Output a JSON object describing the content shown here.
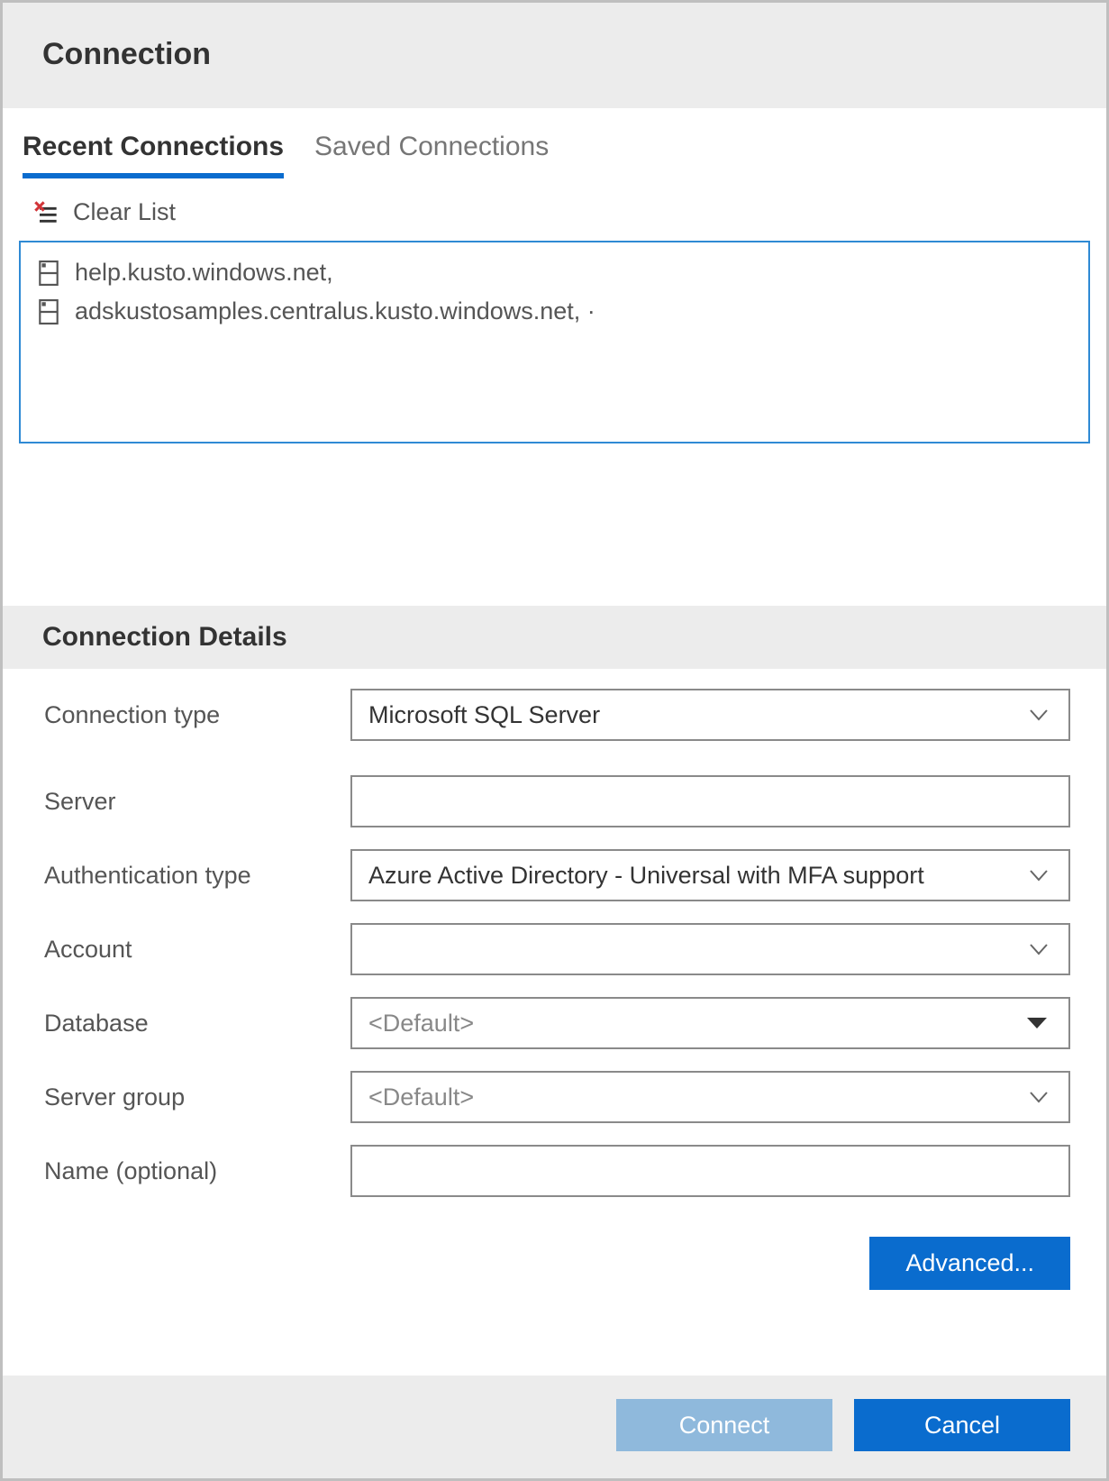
{
  "header": {
    "title": "Connection"
  },
  "tabs": {
    "recent": "Recent Connections",
    "saved": "Saved Connections"
  },
  "toolbar": {
    "clear_label": "Clear List"
  },
  "recent_items": [
    {
      "label": "help.kusto.windows.net,"
    },
    {
      "label": "adskustosamples.centralus.kusto.windows.net,  ·"
    }
  ],
  "details": {
    "heading": "Connection Details",
    "labels": {
      "connection_type": "Connection type",
      "server": "Server",
      "authentication_type": "Authentication type",
      "account": "Account",
      "database": "Database",
      "server_group": "Server group",
      "name_optional": "Name (optional)"
    },
    "values": {
      "connection_type": "Microsoft SQL Server",
      "server": "",
      "authentication_type": "Azure Active Directory - Universal with MFA support",
      "account": "",
      "database": "<Default>",
      "server_group": "<Default>",
      "name_optional": ""
    },
    "advanced_button": "Advanced..."
  },
  "footer": {
    "connect": "Connect",
    "cancel": "Cancel"
  }
}
